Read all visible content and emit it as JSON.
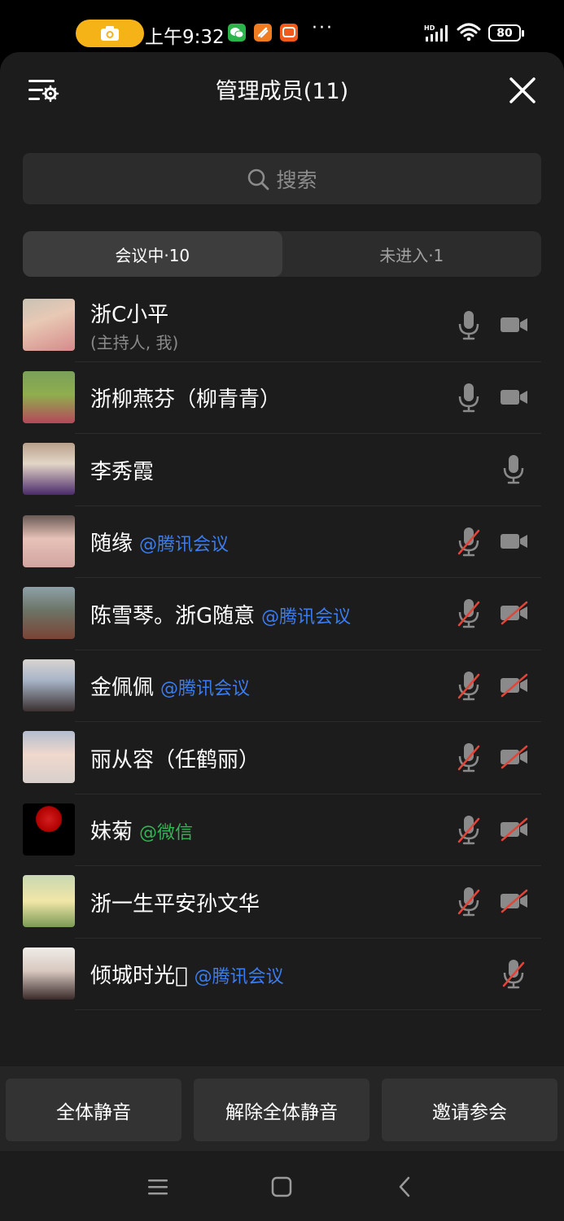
{
  "status": {
    "time": "上午9:32",
    "more": "···",
    "battery": "80",
    "hd": "HD"
  },
  "header": {
    "title": "管理成员(11)"
  },
  "search": {
    "placeholder": "搜索"
  },
  "tabs": [
    {
      "label": "会议中·10",
      "active": true
    },
    {
      "label": "未进入·1",
      "active": false
    }
  ],
  "members": [
    {
      "name": "浙C小平",
      "sub": "(主持人, 我)",
      "tag": "",
      "tag_color": "",
      "mic": "on",
      "cam": "on"
    },
    {
      "name": "浙柳燕芬（柳青青）",
      "sub": "",
      "tag": "",
      "tag_color": "",
      "mic": "on",
      "cam": "on"
    },
    {
      "name": "李秀霞",
      "sub": "",
      "tag": "",
      "tag_color": "",
      "mic": "on",
      "cam": "none"
    },
    {
      "name": "随缘",
      "sub": "",
      "tag": "@腾讯会议",
      "tag_color": "blue",
      "mic": "muted",
      "cam": "on"
    },
    {
      "name": "陈雪琴。浙G随意",
      "sub": "",
      "tag": "@腾讯会议",
      "tag_color": "blue",
      "mic": "muted",
      "cam": "off"
    },
    {
      "name": "金佩佩",
      "sub": "",
      "tag": "@腾讯会议",
      "tag_color": "blue",
      "mic": "muted",
      "cam": "off"
    },
    {
      "name": "丽从容（任鹤丽）",
      "sub": "",
      "tag": "",
      "tag_color": "",
      "mic": "muted",
      "cam": "off"
    },
    {
      "name": "妹菊",
      "sub": "",
      "tag": "@微信",
      "tag_color": "green",
      "mic": "muted",
      "cam": "off"
    },
    {
      "name": "浙一生平安孙文华",
      "sub": "",
      "tag": "",
      "tag_color": "",
      "mic": "muted",
      "cam": "off"
    },
    {
      "name": "倾城时光􀀀",
      "sub": "",
      "tag": "@腾讯会议",
      "tag_color": "blue",
      "mic": "muted",
      "cam": "none"
    }
  ],
  "actions": {
    "mute_all": "全体静音",
    "unmute_all": "解除全体静音",
    "invite": "邀请参会"
  },
  "colors": {
    "panel_bg": "#1c1c1c",
    "link_blue": "#3a7df0",
    "wechat_green": "#2fb554",
    "mute_red": "#e0453a",
    "status_pill": "#f6b318"
  }
}
